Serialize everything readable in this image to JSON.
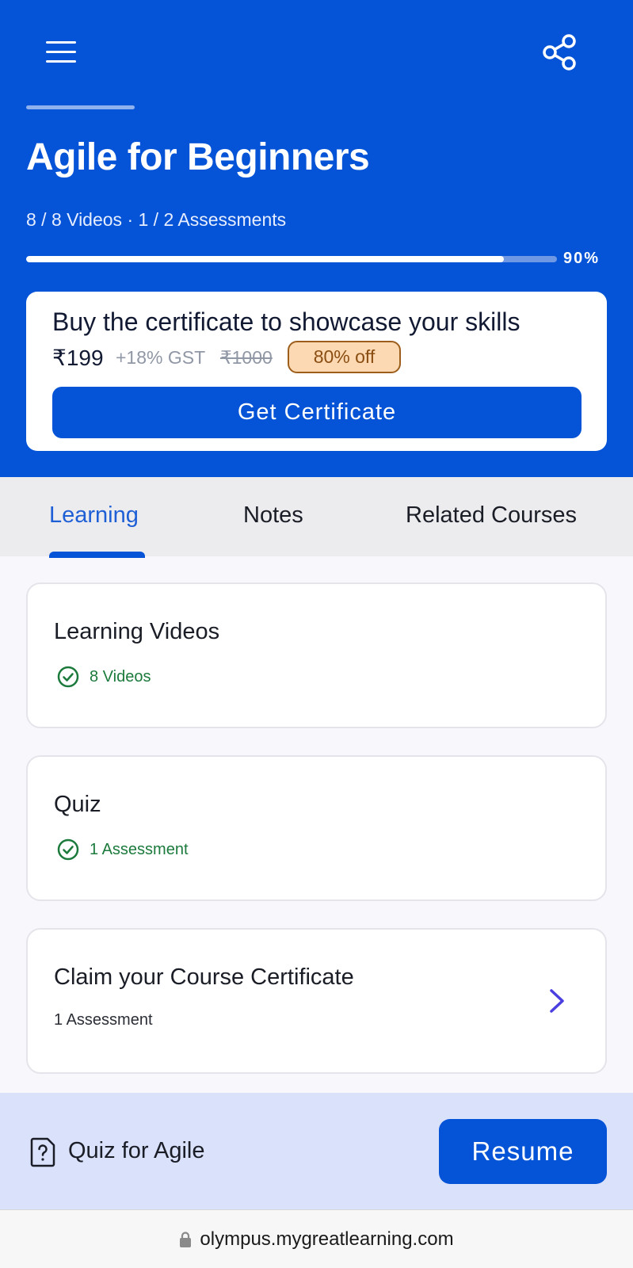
{
  "header": {
    "course_title": "Agile for Beginners",
    "meta": "8 / 8 Videos · 1 / 2 Assessments",
    "progress_percent": 90,
    "progress_label": "90%",
    "background_color": "#0553d6"
  },
  "certificate": {
    "heading": "Buy the certificate to showcase your skills",
    "price": "₹199",
    "gst": "+18% GST",
    "original_price": "₹1000",
    "discount_badge": "80% off",
    "button_label": "Get Certificate"
  },
  "tabs": [
    {
      "label": "Learning",
      "active": true
    },
    {
      "label": "Notes",
      "active": false
    },
    {
      "label": "Related Courses",
      "active": false
    }
  ],
  "cards": [
    {
      "title": "Learning Videos",
      "status": "8 Videos",
      "status_icon": "check-circle-icon"
    },
    {
      "title": "Quiz",
      "status": "1 Assessment",
      "status_icon": "check-circle-icon"
    },
    {
      "title": "Claim your Course Certificate",
      "subtitle": "1 Assessment",
      "action_icon": "chevron-right-icon"
    }
  ],
  "bottom_bar": {
    "item_label": "Quiz for Agile",
    "item_icon": "quiz-icon",
    "button_label": "Resume"
  },
  "browser": {
    "url": "olympus.mygreatlearning.com",
    "lock_icon": "lock-icon"
  },
  "colors": {
    "brand_blue": "#0553d6",
    "success_green": "#1b7a3c",
    "discount_bg": "#fcd9b2",
    "chevron_purple": "#4b3fe0"
  }
}
